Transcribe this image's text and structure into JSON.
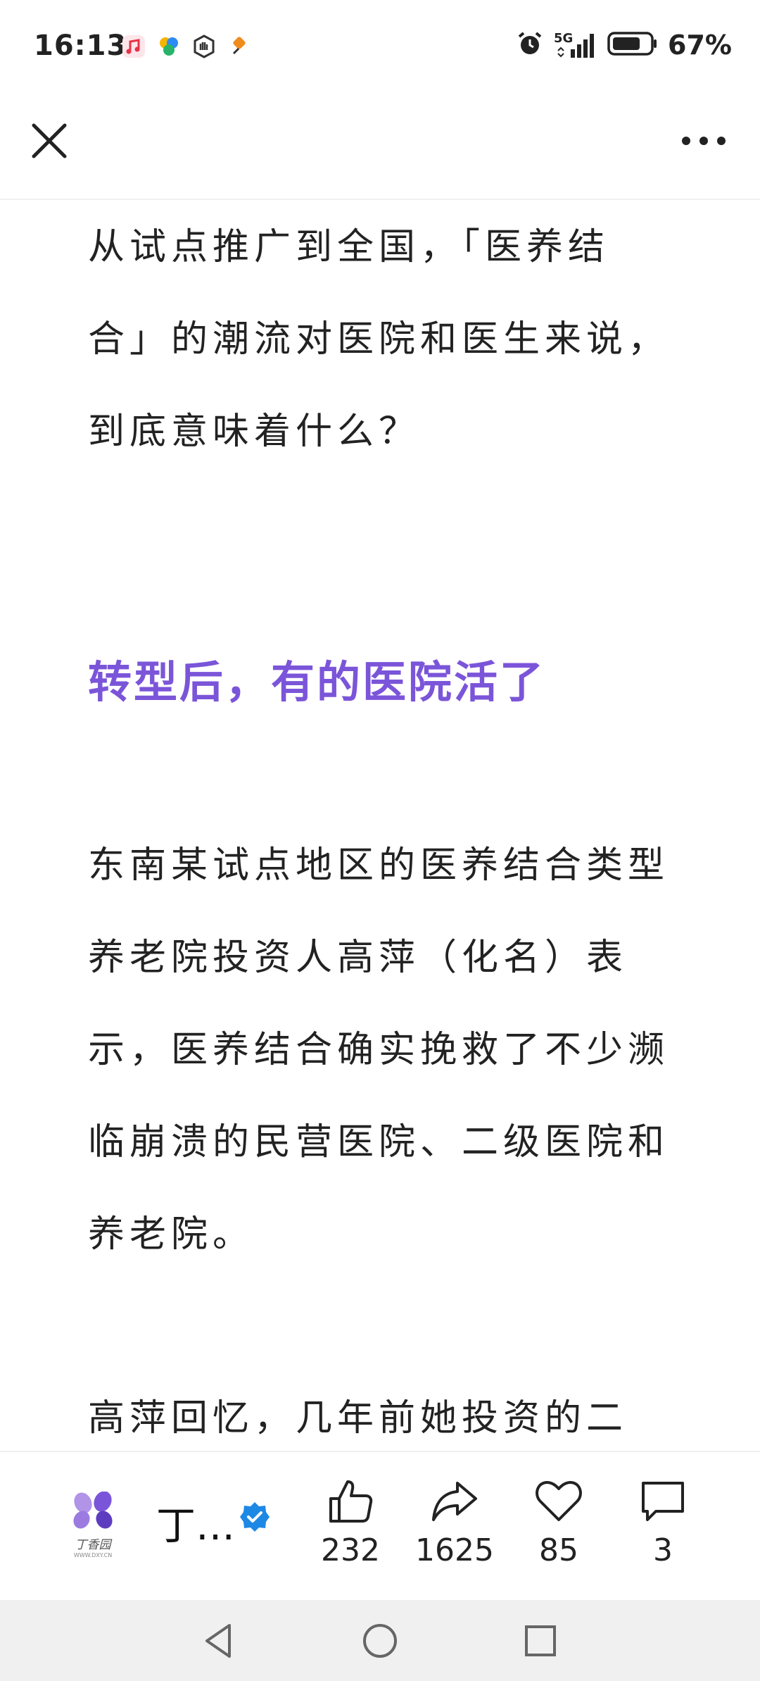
{
  "status_bar": {
    "time": "16:13",
    "network": "5G",
    "battery": "67%"
  },
  "article": {
    "paragraph_intro": "从试点推广到全国，「医养结合」的潮流对医院和医生来说，到底意味着什么？",
    "heading": "转型后，有的医院活了",
    "paragraph_2": "东南某试点地区的医养结合类型养老院投资人高萍（化名）表示，医养结合确实挽救了不少濒临崩溃的民营医院、二级医院和养老院。",
    "paragraph_3": "高萍回忆，几年前她投资的二"
  },
  "bottom_bar": {
    "author_name": "丁…",
    "logo_text": "丁香园",
    "logo_subtext": "WWW.DXY.CN",
    "likes": "232",
    "shares": "1625",
    "favorites": "85",
    "comments": "3"
  },
  "colors": {
    "heading": "#7b55d9",
    "verified": "#1e88e5",
    "nav_bg": "#f0f0f0"
  }
}
